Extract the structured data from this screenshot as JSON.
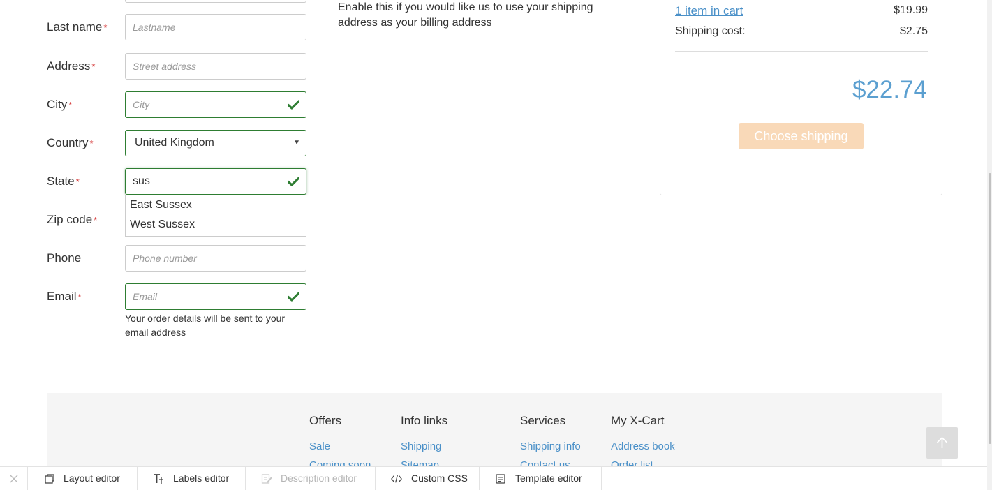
{
  "form": {
    "lastname": {
      "label": "Last name",
      "placeholder": "Lastname",
      "value": ""
    },
    "address": {
      "label": "Address",
      "placeholder": "Street address",
      "value": ""
    },
    "city": {
      "label": "City",
      "placeholder": "City",
      "value": ""
    },
    "country": {
      "label": "Country",
      "value": "United Kingdom"
    },
    "state": {
      "label": "State",
      "value": "sus",
      "suggestions": [
        "East Sussex",
        "West Sussex"
      ]
    },
    "zip": {
      "label": "Zip code"
    },
    "phone": {
      "label": "Phone",
      "placeholder": "Phone number",
      "value": ""
    },
    "email": {
      "label": "Email",
      "placeholder": "Email",
      "value": "",
      "help": "Your order details will be sent to your email address"
    },
    "required_mark": "*"
  },
  "billing_note": "Enable this if you would like us to use your shipping address as your billing address",
  "summary": {
    "items_link": "1 item in cart",
    "items_price": "$19.99",
    "shipping_label": "Shipping cost:",
    "shipping_price": "$2.75",
    "total": "$22.74",
    "choose_shipping": "Choose shipping"
  },
  "footer": {
    "columns": [
      {
        "title": "Offers",
        "links": [
          "Sale",
          "Coming soon"
        ]
      },
      {
        "title": "Info links",
        "links": [
          "Shipping",
          "Sitemap"
        ]
      },
      {
        "title": "Services",
        "links": [
          "Shipping info",
          "Contact us"
        ]
      },
      {
        "title": "My X-Cart",
        "links": [
          "Address book",
          "Order list"
        ]
      }
    ]
  },
  "editor_bar": {
    "items": [
      {
        "label": "Layout editor",
        "icon": "layout-icon",
        "disabled": false
      },
      {
        "label": "Labels editor",
        "icon": "text-icon",
        "disabled": false
      },
      {
        "label": "Description editor",
        "icon": "edit-doc-icon",
        "disabled": true
      },
      {
        "label": "Custom CSS",
        "icon": "code-icon",
        "disabled": false
      },
      {
        "label": "Template editor",
        "icon": "template-icon",
        "disabled": false
      }
    ]
  },
  "colors": {
    "link": "#4a90c8",
    "total": "#5b9fd0",
    "valid": "#2e7d32",
    "required": "#d63a3a",
    "button_disabled": "#f9d9b8"
  }
}
